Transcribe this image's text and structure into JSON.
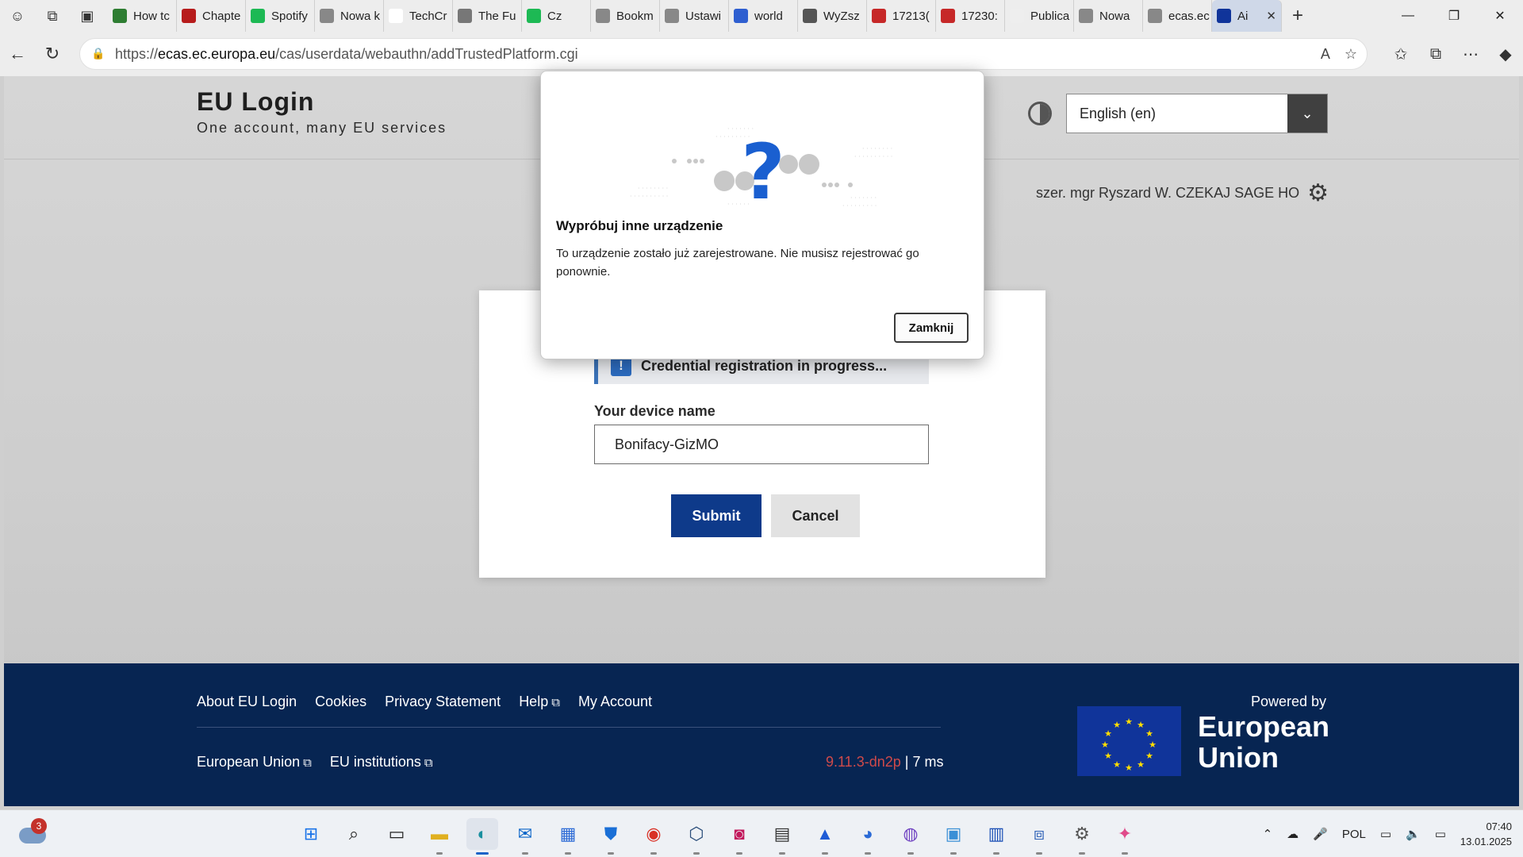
{
  "browser": {
    "tabs": [
      {
        "label": "How tc",
        "color": "#2e7d32"
      },
      {
        "label": "Chapte",
        "color": "#b71c1c"
      },
      {
        "label": "Spotify",
        "color": "#1db954"
      },
      {
        "label": "Nowa k",
        "color": "#888888"
      },
      {
        "label": "TechCr",
        "color": "#ffffff"
      },
      {
        "label": "The Fu",
        "color": "#777777"
      },
      {
        "label": "Cz",
        "color": "#1db954"
      },
      {
        "label": "Bookm",
        "color": "#888888"
      },
      {
        "label": "Ustawi",
        "color": "#888888"
      },
      {
        "label": "world",
        "color": "#2f5fd0"
      },
      {
        "label": "WyZsz",
        "color": "#555555"
      },
      {
        "label": "17213(",
        "color": "#c62828"
      },
      {
        "label": "17230:",
        "color": "#c62828"
      },
      {
        "label": "Publica",
        "color": "#eeeeee"
      },
      {
        "label": "Nowa",
        "color": "#888888"
      },
      {
        "label": "ecas.ec",
        "color": "#888888"
      },
      {
        "label": "Ai",
        "color": "#10349a"
      }
    ],
    "url_prefix": "https://",
    "url_domain": "ecas.ec.europa.eu",
    "url_path": "/cas/userdata/webauthn/addTrustedPlatform.cgi"
  },
  "header": {
    "title": "EU Login",
    "subtitle": "One account, many EU services",
    "language": "English (en)",
    "user": "szer. mgr Ryszard W. CZEKAJ SAGE HO"
  },
  "form": {
    "progress_message": "Credential registration in progress...",
    "device_label": "Your device name",
    "device_value": "Bonifacy-GizMO",
    "submit_label": "Submit",
    "cancel_label": "Cancel"
  },
  "dialog": {
    "title": "Wypróbuj inne urządzenie",
    "message": "To urządzenie zostało już zarejestrowane. Nie musisz rejestrować go ponownie.",
    "close_label": "Zamknij"
  },
  "footer": {
    "links": [
      "About EU Login",
      "Cookies",
      "Privacy Statement",
      "Help",
      "My Account"
    ],
    "links2": [
      "European Union",
      "EU institutions"
    ],
    "version": "9.11.3-dn2p",
    "timing": "| 7 ms",
    "powered_by": "Powered by",
    "eu_name_line1": "European",
    "eu_name_line2": "Union"
  },
  "taskbar": {
    "weather_badge": "3",
    "language": "POL",
    "time": "07:40",
    "date": "13.01.2025"
  },
  "colors": {
    "eu_blue": "#072552",
    "submit_blue": "#0e3a8a",
    "info_blue": "#3b73b9",
    "version_red": "#d04a4a"
  }
}
